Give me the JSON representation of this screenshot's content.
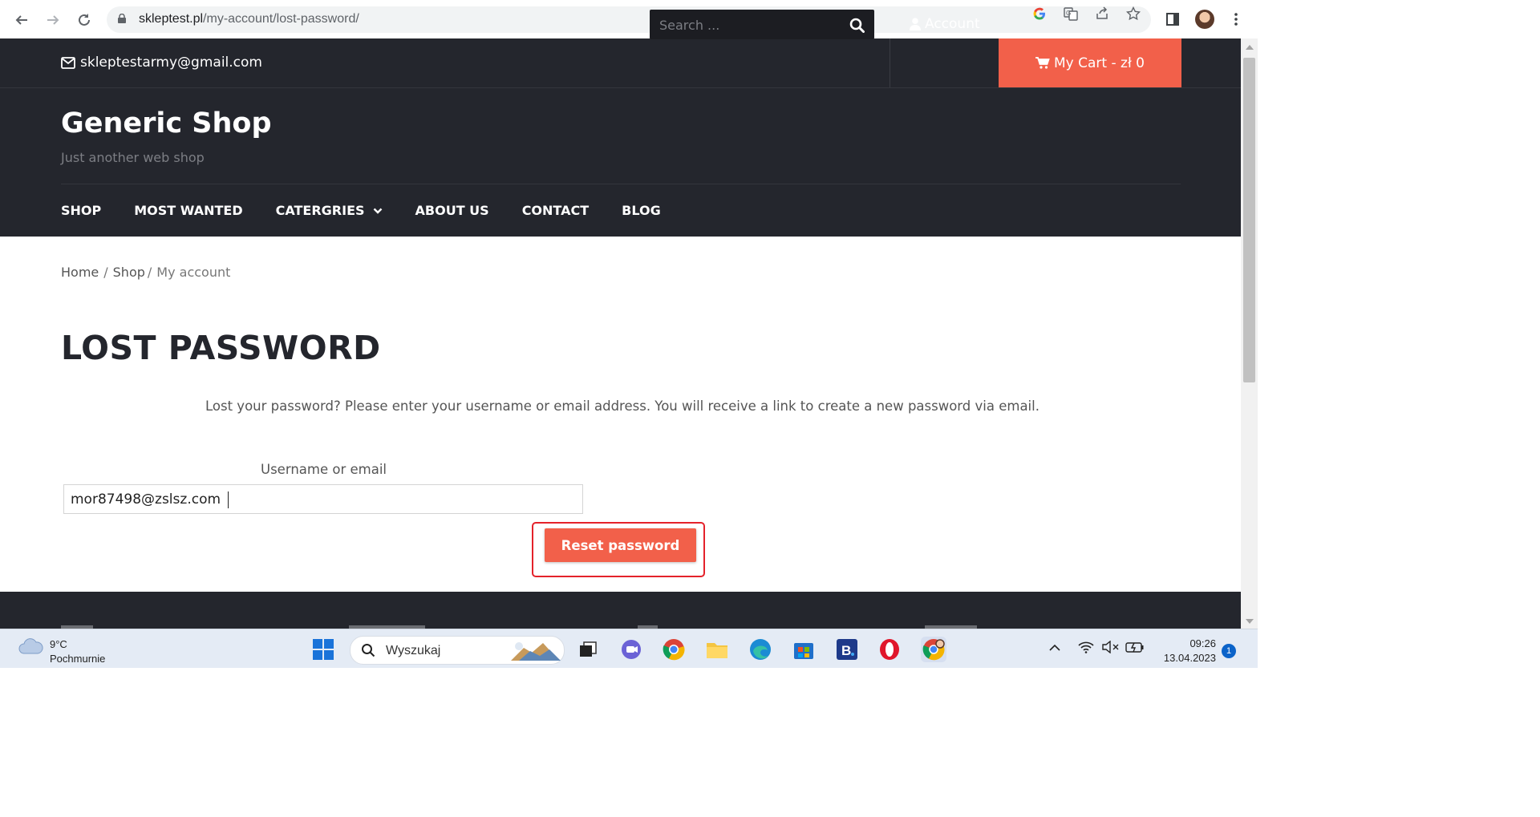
{
  "browser": {
    "url_domain": "skleptest.pl",
    "url_path": "/my-account/lost-password/",
    "translate_icon": "translate-icon",
    "google_icon": "google-icon"
  },
  "topbar": {
    "email": "skleptestarmy@gmail.com",
    "search_placeholder": "Search ...",
    "account_label": "Account",
    "cart_label": "My Cart - zł 0"
  },
  "header": {
    "site_title": "Generic Shop",
    "tagline": "Just another web shop",
    "menu": [
      {
        "label": "SHOP"
      },
      {
        "label": "MOST WANTED"
      },
      {
        "label": "CATERGRIES"
      },
      {
        "label": "ABOUT US"
      },
      {
        "label": "CONTACT"
      },
      {
        "label": "BLOG"
      }
    ]
  },
  "breadcrumb": {
    "home": "Home",
    "shop": "Shop",
    "current": "My account",
    "separator": "/"
  },
  "main": {
    "page_title": "LOST PASSWORD",
    "intro": "Lost your password? Please enter your username or email address. You will receive a link to create a new password via email.",
    "field_label": "Username or email",
    "field_value": "mor87498@zslsz.com",
    "reset_button": "Reset password"
  },
  "taskbar": {
    "temperature": "9°C",
    "condition": "Pochmurnie",
    "search_label": "Wyszukaj",
    "time": "09:26",
    "date": "13.04.2023",
    "notifications": "1"
  },
  "colors": {
    "dark_bg": "#24262d",
    "accent": "#f2604a",
    "highlight_border": "#e4222b"
  }
}
